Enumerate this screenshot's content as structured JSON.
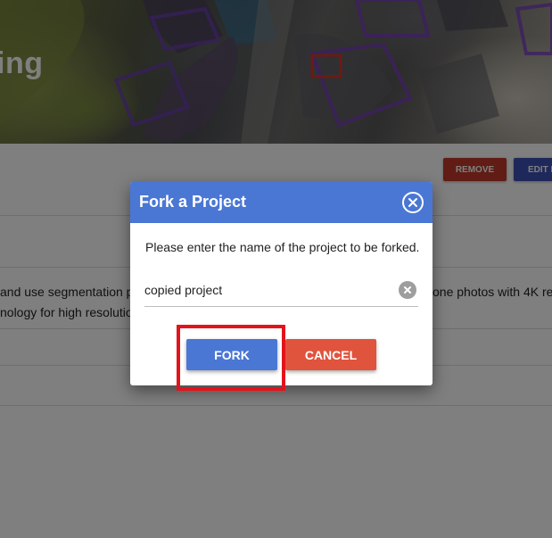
{
  "page": {
    "hero_title": "ing",
    "remove_label": "REMOVE",
    "edit_label": "EDIT D",
    "description_left_line1": "and use segmentation p",
    "description_left_line2": "nology for high resolutio",
    "description_right_line1": "one photos with 4K re"
  },
  "dialog": {
    "title": "Fork a Project",
    "message": "Please enter the name of the project to be forked.",
    "input_value": "copied project",
    "fork_label": "FORK",
    "cancel_label": "CANCEL"
  },
  "colors": {
    "dialog_header": "#4a77d4",
    "fork_button": "#4a77d4",
    "cancel_button": "#e0533d",
    "remove_button": "#c0392b",
    "edit_button": "#3f51b5",
    "highlight": "#e3131b"
  },
  "icons": {
    "close": "close-icon",
    "clear": "clear-icon"
  }
}
